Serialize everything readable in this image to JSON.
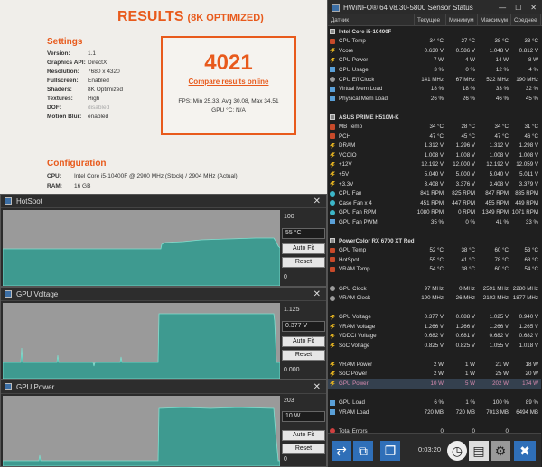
{
  "results": {
    "title": "RESULTS",
    "subtitle": "(8K OPTIMIZED)",
    "settings_heading": "Settings",
    "settings": [
      {
        "k": "Version:",
        "v": "1.1",
        "dim": false
      },
      {
        "k": "Graphics API:",
        "v": "DirectX",
        "dim": false
      },
      {
        "k": "Resolution:",
        "v": "7680 x 4320",
        "dim": false
      },
      {
        "k": "Fullscreen:",
        "v": "Enabled",
        "dim": false
      },
      {
        "k": "Shaders:",
        "v": "8K Optimized",
        "dim": false
      },
      {
        "k": "Textures:",
        "v": "High",
        "dim": false
      },
      {
        "k": "DOF:",
        "v": "disabled",
        "dim": true
      },
      {
        "k": "Motion Blur:",
        "v": "enabled",
        "dim": false
      }
    ],
    "score": "4021",
    "compare_link": "Compare results online",
    "fps_line": "FPS: Min 25.33, Avg 30.08, Max 34.51",
    "gpu_line": "GPU °C: N/A",
    "config_heading": "Configuration",
    "config": [
      {
        "k": "CPU:",
        "v": "Intel Core i5-10400F @ 2900 MHz (Stock) / 2904 MHz (Actual)"
      },
      {
        "k": "RAM:",
        "v": "16 GB"
      }
    ]
  },
  "graphs": [
    {
      "title": "HotSpot",
      "max": "100",
      "current": "55 °C",
      "min": "0",
      "autofit": "Auto Fit",
      "reset": "Reset"
    },
    {
      "title": "GPU Voltage",
      "max": "1.125",
      "current": "0.377 V",
      "min": "0.000",
      "autofit": "Auto Fit",
      "reset": "Reset"
    },
    {
      "title": "GPU Power",
      "max": "203",
      "current": "10 W",
      "min": "0",
      "autofit": "Auto Fit",
      "reset": "Reset"
    }
  ],
  "hwinfo": {
    "title": "HWiNFO® 64 v8.30-5800 Sensor Status",
    "columns": [
      "Датчик",
      "Текущее",
      "Минимум",
      "Максимум",
      "Среднее"
    ],
    "rows": [
      {
        "type": "group",
        "label": "Intel Core i5-10400F"
      },
      {
        "icon": "temp",
        "label": "CPU Temp",
        "cur": "34 °C",
        "min": "27 °C",
        "max": "38 °C",
        "avg": "33 °C"
      },
      {
        "icon": "volt",
        "label": "Vcore",
        "cur": "0.630 V",
        "min": "0.586 V",
        "max": "1.048 V",
        "avg": "0.812 V"
      },
      {
        "icon": "pwr",
        "label": "CPU Power",
        "cur": "7 W",
        "min": "4 W",
        "max": "14 W",
        "avg": "8 W"
      },
      {
        "icon": "pct",
        "label": "CPU Usage",
        "cur": "3 %",
        "min": "0 %",
        "max": "12 %",
        "avg": "4 %"
      },
      {
        "icon": "clk",
        "label": "CPU Eff Clock",
        "cur": "141 MHz",
        "min": "67 MHz",
        "max": "522 MHz",
        "avg": "190 MHz"
      },
      {
        "icon": "pct",
        "label": "Virtual Mem Load",
        "cur": "18 %",
        "min": "18 %",
        "max": "33 %",
        "avg": "32 %"
      },
      {
        "icon": "pct",
        "label": "Physical Mem Load",
        "cur": "26 %",
        "min": "26 %",
        "max": "46 %",
        "avg": "45 %"
      },
      {
        "type": "blank"
      },
      {
        "type": "group",
        "label": "ASUS PRIME H510M-K"
      },
      {
        "icon": "temp",
        "label": "MB Temp",
        "cur": "34 °C",
        "min": "28 °C",
        "max": "34 °C",
        "avg": "31 °C"
      },
      {
        "icon": "temp",
        "label": "PCH",
        "cur": "47 °C",
        "min": "45 °C",
        "max": "47 °C",
        "avg": "46 °C"
      },
      {
        "icon": "volt",
        "label": "DRAM",
        "cur": "1.312 V",
        "min": "1.296 V",
        "max": "1.312 V",
        "avg": "1.298 V"
      },
      {
        "icon": "volt",
        "label": "VCCIO",
        "cur": "1.008 V",
        "min": "1.008 V",
        "max": "1.008 V",
        "avg": "1.008 V"
      },
      {
        "icon": "volt",
        "label": "+12V",
        "cur": "12.192 V",
        "min": "12.000 V",
        "max": "12.192 V",
        "avg": "12.059 V"
      },
      {
        "icon": "volt",
        "label": "+5V",
        "cur": "5.040 V",
        "min": "5.000 V",
        "max": "5.040 V",
        "avg": "5.011 V"
      },
      {
        "icon": "volt",
        "label": "+3.3V",
        "cur": "3.408 V",
        "min": "3.376 V",
        "max": "3.408 V",
        "avg": "3.379 V"
      },
      {
        "icon": "fan",
        "label": "CPU Fan",
        "cur": "841 RPM",
        "min": "825 RPM",
        "max": "847 RPM",
        "avg": "835 RPM"
      },
      {
        "icon": "fan",
        "label": "Case Fan x 4",
        "cur": "451 RPM",
        "min": "447 RPM",
        "max": "455 RPM",
        "avg": "449 RPM"
      },
      {
        "icon": "fan",
        "label": "GPU Fan RPM",
        "cur": "1080 RPM",
        "min": "0 RPM",
        "max": "1349 RPM",
        "avg": "1071 RPM"
      },
      {
        "icon": "pct",
        "label": "GPU Fan PWM",
        "cur": "35 %",
        "min": "0 %",
        "max": "41 %",
        "avg": "33 %"
      },
      {
        "type": "blank"
      },
      {
        "type": "group",
        "label": "PowerColor RX 6700 XT Red Devil"
      },
      {
        "icon": "temp",
        "label": "GPU Temp",
        "cur": "52 °C",
        "min": "38 °C",
        "max": "60 °C",
        "avg": "53 °C"
      },
      {
        "icon": "temp",
        "label": "HotSpot",
        "cur": "55 °C",
        "min": "41 °C",
        "max": "78 °C",
        "avg": "68 °C"
      },
      {
        "icon": "temp",
        "label": "VRAM Temp",
        "cur": "54 °C",
        "min": "38 °C",
        "max": "60 °C",
        "avg": "54 °C"
      },
      {
        "type": "blank"
      },
      {
        "icon": "clk",
        "label": "GPU Clock",
        "cur": "97 MHz",
        "min": "0 MHz",
        "max": "2591 MHz",
        "avg": "2280 MHz"
      },
      {
        "icon": "clk",
        "label": "VRAM Clock",
        "cur": "190 MHz",
        "min": "26 MHz",
        "max": "2102 MHz",
        "avg": "1877 MHz"
      },
      {
        "type": "blank"
      },
      {
        "icon": "volt",
        "label": "GPU Voltage",
        "cur": "0.377 V",
        "min": "0.088 V",
        "max": "1.025 V",
        "avg": "0.940 V"
      },
      {
        "icon": "volt",
        "label": "VRAM Voltage",
        "cur": "1.266 V",
        "min": "1.266 V",
        "max": "1.266 V",
        "avg": "1.265 V"
      },
      {
        "icon": "volt",
        "label": "VDDCI Voltage",
        "cur": "0.682 V",
        "min": "0.681 V",
        "max": "0.682 V",
        "avg": "0.682 V"
      },
      {
        "icon": "volt",
        "label": "SoC Voltage",
        "cur": "0.825 V",
        "min": "0.825 V",
        "max": "1.055 V",
        "avg": "1.018 V"
      },
      {
        "type": "blank"
      },
      {
        "icon": "pwr",
        "label": "VRAM Power",
        "cur": "2 W",
        "min": "1 W",
        "max": "21 W",
        "avg": "18 W"
      },
      {
        "icon": "pwr",
        "label": "SoC Power",
        "cur": "2 W",
        "min": "1 W",
        "max": "25 W",
        "avg": "20 W"
      },
      {
        "icon": "pwr",
        "label": "GPU Power",
        "cur": "10 W",
        "min": "5 W",
        "max": "202 W",
        "avg": "174 W",
        "highlight": true
      },
      {
        "type": "blank"
      },
      {
        "icon": "pct",
        "label": "GPU Load",
        "cur": "6 %",
        "min": "1 %",
        "max": "100 %",
        "avg": "89 %"
      },
      {
        "icon": "pct",
        "label": "VRAM Load",
        "cur": "720 MB",
        "min": "720 MB",
        "max": "7013 MB",
        "avg": "6494 MB"
      },
      {
        "type": "blank"
      },
      {
        "icon": "err",
        "label": "Total Errors",
        "cur": "0",
        "min": "0",
        "max": "0",
        "avg": ""
      }
    ],
    "elapsed": "0:03:20"
  }
}
